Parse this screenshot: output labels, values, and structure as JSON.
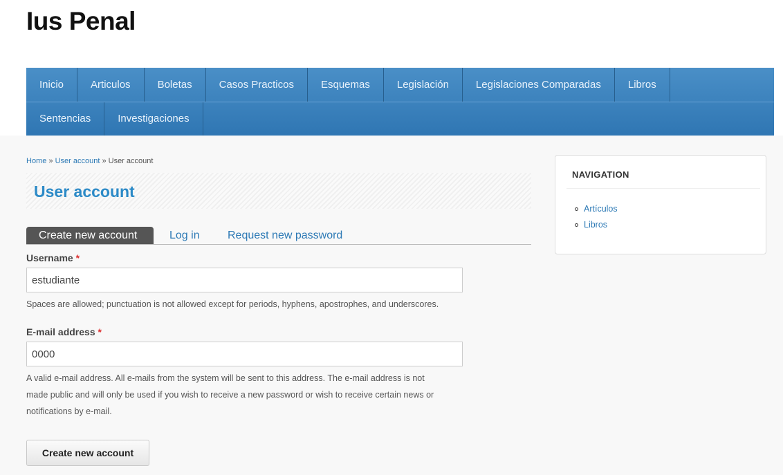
{
  "site": {
    "name": "Ius Penal"
  },
  "menu": {
    "row1": [
      "Inicio",
      "Articulos",
      "Boletas",
      "Casos Practicos",
      "Esquemas",
      "Legislación",
      "Legislaciones Comparadas",
      "Libros"
    ],
    "row2": [
      "Sentencias",
      "Investigaciones"
    ]
  },
  "breadcrumb": {
    "home": "Home",
    "sep1": " » ",
    "user_account_link": "User account",
    "sep2": " » ",
    "current": "User account"
  },
  "page": {
    "title": "User account"
  },
  "tabs": {
    "create": "Create new account",
    "login": "Log in",
    "request": "Request new password"
  },
  "form": {
    "username": {
      "label": "Username",
      "required_mark": "*",
      "value": "estudiante",
      "description": "Spaces are allowed; punctuation is not allowed except for periods, hyphens, apostrophes, and underscores."
    },
    "email": {
      "label": "E-mail address",
      "required_mark": "*",
      "value": "0000",
      "description_line1": "A valid e-mail address. All e-mails from the system will be sent to this address. The e-mail address is not",
      "description_line2": "made public and will only be used if you wish to receive a new password or wish to receive certain news or",
      "description_line3": "notifications by e-mail."
    },
    "submit_label": "Create new account"
  },
  "sidebar": {
    "title": "NAVIGATION",
    "links": [
      "Artículos",
      "Libros"
    ]
  }
}
